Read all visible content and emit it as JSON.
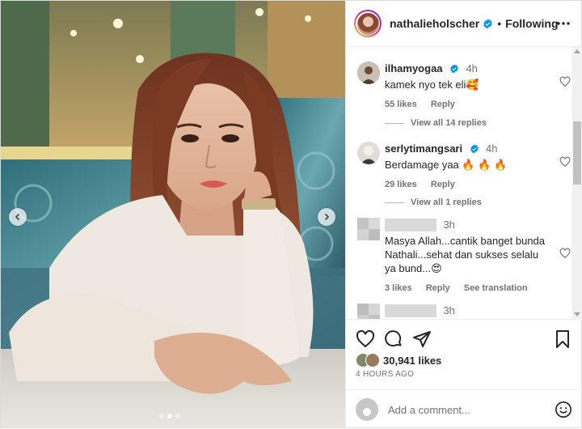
{
  "header": {
    "username": "nathalieholscher",
    "separator": "•",
    "follow_status": "Following"
  },
  "comments": [
    {
      "username": "ilhamyogaa",
      "verified": true,
      "time": "4h",
      "text": "kamek nyo tek eli🥰",
      "likes": "55 likes",
      "reply": "Reply",
      "view_replies": "View all 14 replies"
    },
    {
      "username": "serlytimangsari",
      "verified": true,
      "time": "4h",
      "text": "Berdamage yaa 🔥 🔥 🔥",
      "likes": "29 likes",
      "reply": "Reply",
      "view_replies": "View all 1 replies"
    },
    {
      "username": "",
      "time": "3h",
      "text": "Masya Allah...cantik banget bunda Nathali...sehat dan sukses selalu ya bund...😍",
      "likes": "3 likes",
      "reply": "Reply",
      "translate": "See translation"
    },
    {
      "username": "",
      "time": "3h"
    }
  ],
  "footer": {
    "likes_count": "30,941 likes",
    "post_time": "4 HOURS AGO",
    "comment_placeholder": "Add a comment..."
  },
  "carousel": {
    "slides": 3,
    "active_index": 1
  },
  "colors": {
    "verified_blue": "#0095f6",
    "muted_text": "#737373",
    "text": "#262626"
  },
  "icons": {
    "verified": "verified-badge-icon",
    "more": "more-options-icon",
    "like": "heart-icon",
    "comment": "comment-icon",
    "share": "send-icon",
    "save": "bookmark-icon",
    "emoji": "emoji-icon",
    "prev": "chevron-left-icon",
    "next": "chevron-right-icon"
  }
}
